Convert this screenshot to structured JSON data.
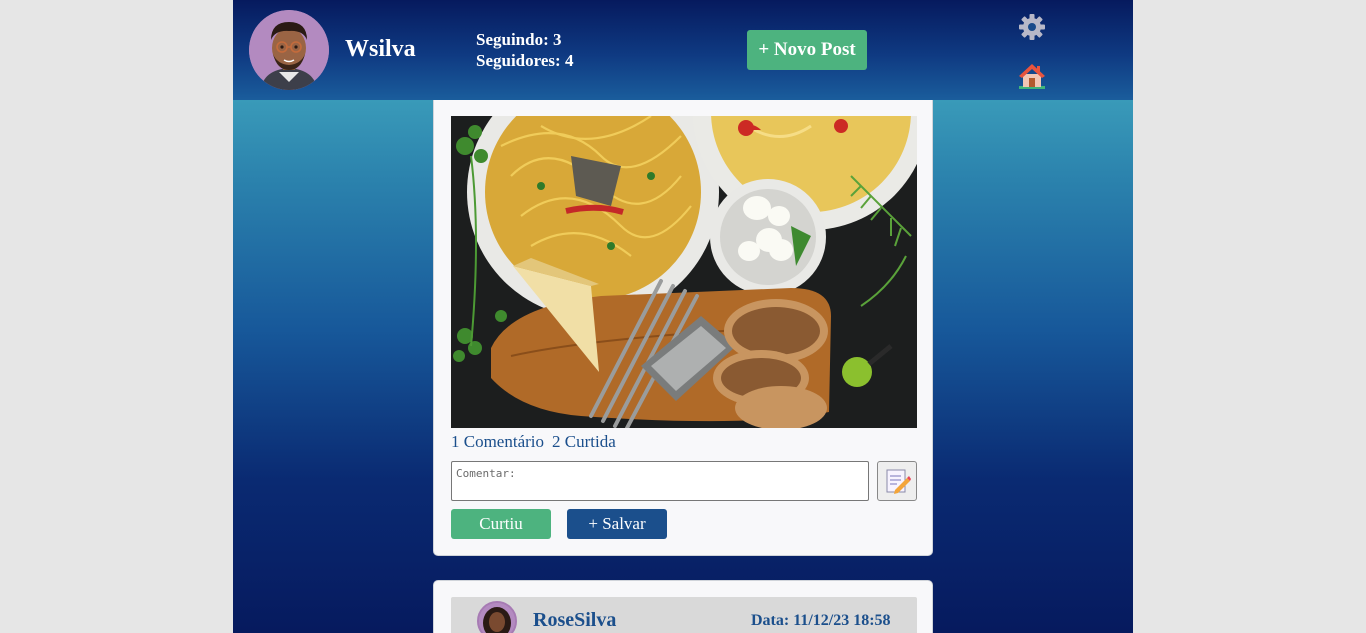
{
  "profile": {
    "username": "Wsilva",
    "following": "Seguindo: 3",
    "followers": "Seguidores: 4"
  },
  "header": {
    "new_post_label": "+ Novo Post",
    "settings_icon": "gear-icon",
    "home_icon": "home-icon"
  },
  "post": {
    "image_alt": "pasta dish with mozzarella, bread and grater",
    "comments_count": "1 Comentário",
    "likes_count": "2 Curtida",
    "comment_placeholder": "Comentar:",
    "like_label": "Curtiu",
    "save_label": "+ Salvar"
  },
  "next_post": {
    "user": "RoseSilva",
    "date": "Data: 11/12/23 18:58"
  },
  "colors": {
    "header_dark": "#061a5e",
    "accent_green": "#4db37f",
    "accent_blue": "#1b4f8c"
  }
}
